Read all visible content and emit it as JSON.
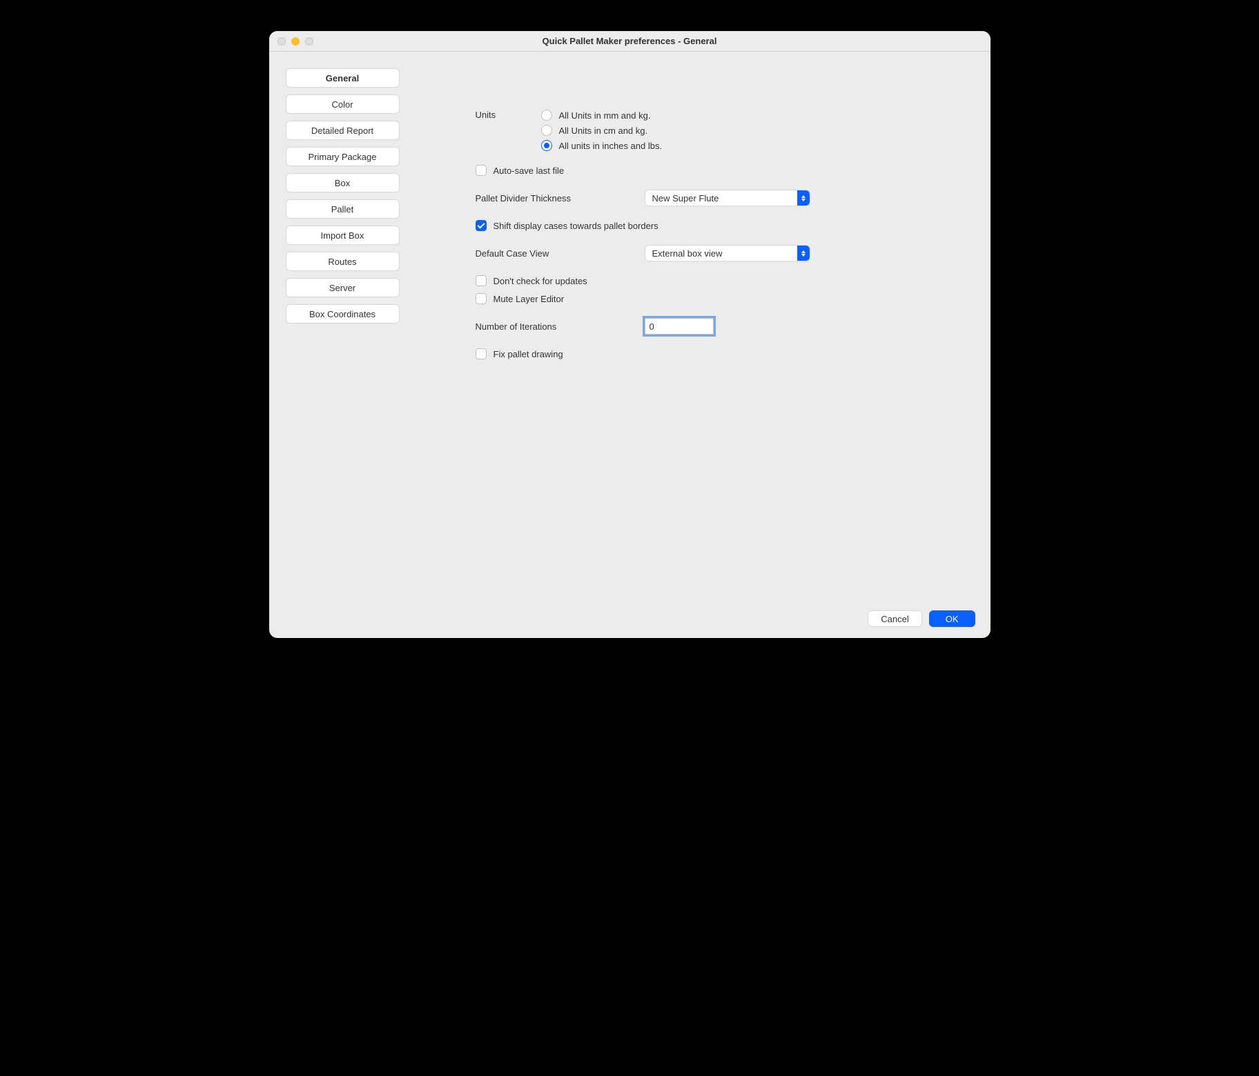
{
  "window": {
    "title": "Quick Pallet Maker preferences - General"
  },
  "sidebar": {
    "items": [
      {
        "label": "General",
        "active": true
      },
      {
        "label": "Color",
        "active": false
      },
      {
        "label": "Detailed Report",
        "active": false
      },
      {
        "label": "Primary Package",
        "active": false
      },
      {
        "label": "Box",
        "active": false
      },
      {
        "label": "Pallet",
        "active": false
      },
      {
        "label": "Import Box",
        "active": false
      },
      {
        "label": "Routes",
        "active": false
      },
      {
        "label": "Server",
        "active": false
      },
      {
        "label": "Box Coordinates",
        "active": false
      }
    ]
  },
  "form": {
    "units_label": "Units",
    "units_options": [
      {
        "label": "All Units in mm and kg.",
        "selected": false
      },
      {
        "label": "All Units in cm and kg.",
        "selected": false
      },
      {
        "label": "All units in inches and lbs.",
        "selected": true
      }
    ],
    "autosave_label": "Auto-save last file",
    "autosave_checked": false,
    "divider_label": "Pallet Divider Thickness",
    "divider_value": "New Super Flute",
    "shift_label": "Shift display cases towards pallet borders",
    "shift_checked": true,
    "caseview_label": "Default Case View",
    "caseview_value": "External box view",
    "updates_label": "Don't check for updates",
    "updates_checked": false,
    "mute_label": "Mute Layer Editor",
    "mute_checked": false,
    "iterations_label": "Number of Iterations",
    "iterations_value": "0",
    "fixpallet_label": "Fix pallet drawing",
    "fixpallet_checked": false
  },
  "footer": {
    "cancel": "Cancel",
    "ok": "OK"
  }
}
